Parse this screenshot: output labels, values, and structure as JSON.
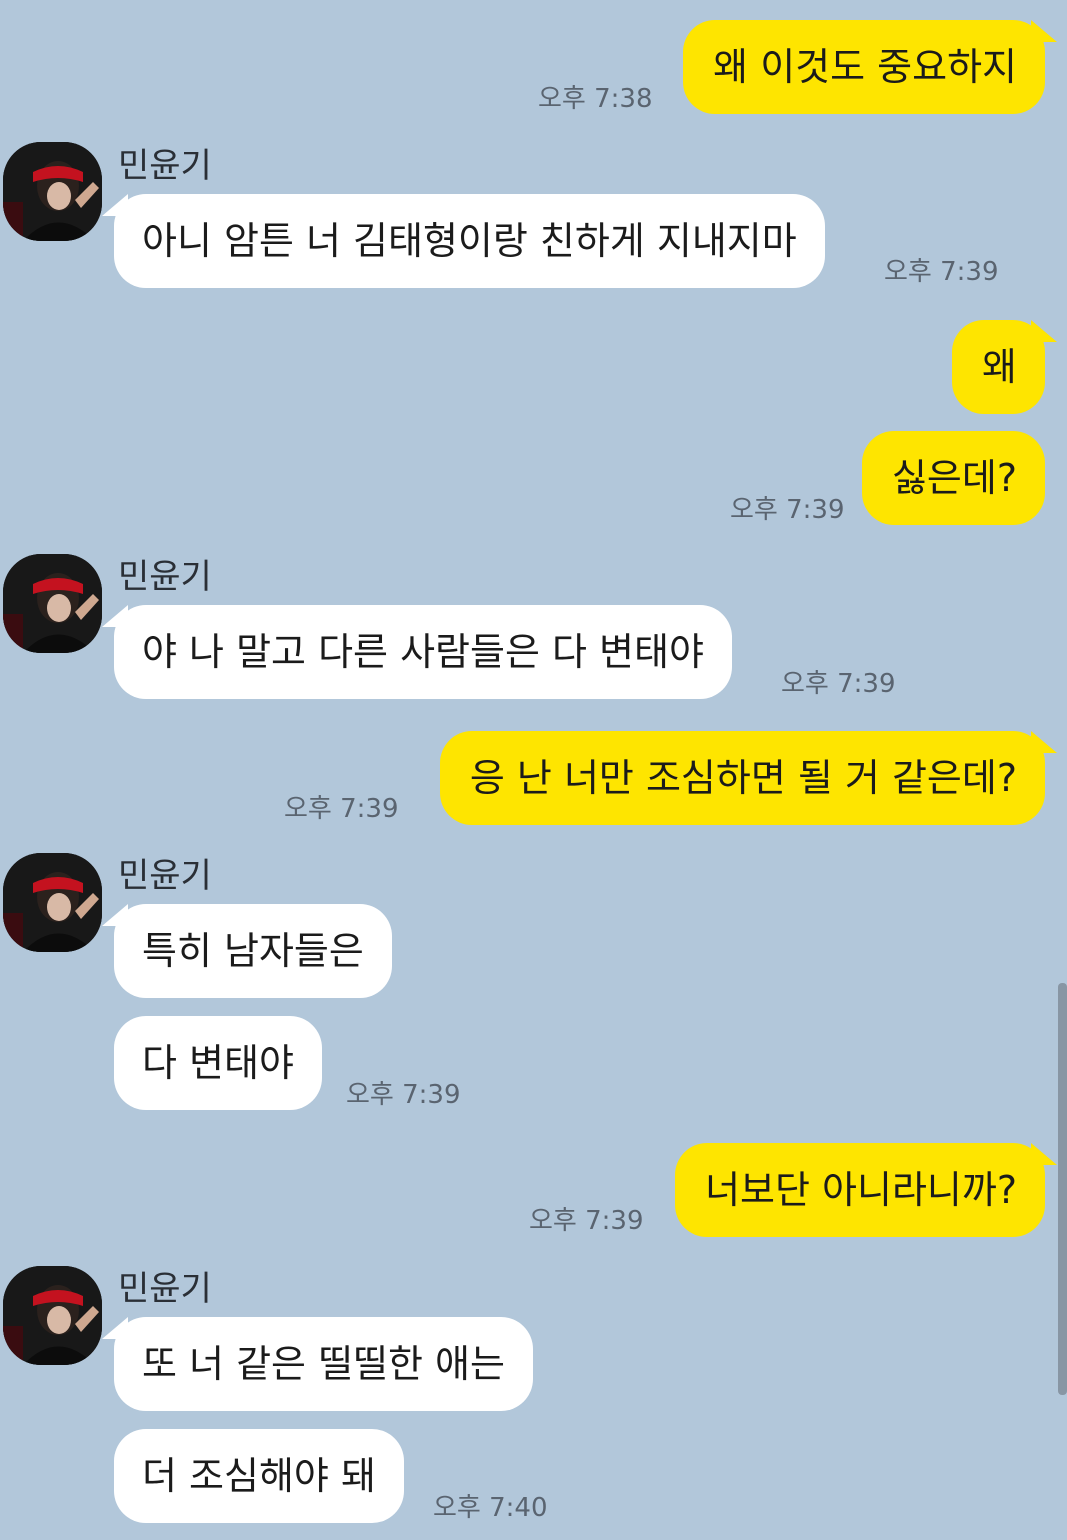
{
  "contact": {
    "name": "민윤기"
  },
  "messages": [
    {
      "sender": "me",
      "text": "왜 이것도 중요하지",
      "time": "오후 7:38"
    },
    {
      "sender": "contact",
      "text": "아니 암튼 너 김태형이랑 친하게 지내지마",
      "time": "오후 7:39"
    },
    {
      "sender": "me",
      "text": "왜"
    },
    {
      "sender": "me",
      "text": "싫은데?",
      "time": "오후 7:39"
    },
    {
      "sender": "contact",
      "text": "야 나 말고 다른 사람들은 다 변태야",
      "time": "오후 7:39"
    },
    {
      "sender": "me",
      "text": "응 난 너만 조심하면 될 거 같은데?",
      "time": "오후 7:39"
    },
    {
      "sender": "contact",
      "text": "특히 남자들은"
    },
    {
      "sender": "contact",
      "text": "다 변태야",
      "time": "오후 7:39"
    },
    {
      "sender": "me",
      "text": "너보단 아니라니까?",
      "time": "오후 7:39"
    },
    {
      "sender": "contact",
      "text": "또 너 같은 띨띨한 애는"
    },
    {
      "sender": "contact",
      "text": "더 조심해야 돼",
      "time": "오후 7:40"
    }
  ],
  "colors": {
    "background": "#b2c7da",
    "my_bubble": "#fee500",
    "their_bubble": "#ffffff"
  },
  "icons": {
    "avatar": "profile-photo"
  }
}
